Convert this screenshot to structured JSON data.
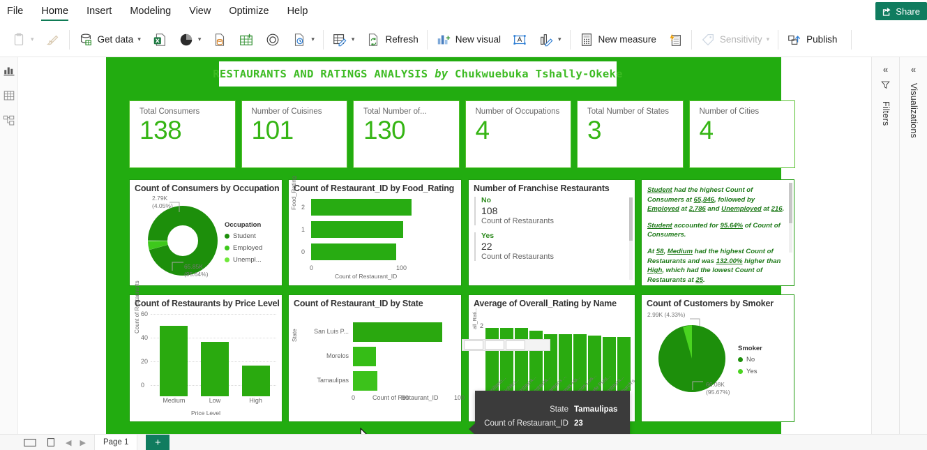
{
  "menu": {
    "items": [
      {
        "label": "File",
        "active": false
      },
      {
        "label": "Home",
        "active": true
      },
      {
        "label": "Insert",
        "active": false
      },
      {
        "label": "Modeling",
        "active": false
      },
      {
        "label": "View",
        "active": false
      },
      {
        "label": "Optimize",
        "active": false
      },
      {
        "label": "Help",
        "active": false
      }
    ],
    "share_label": "Share"
  },
  "ribbon": {
    "paste_label": "",
    "get_data_label": "Get data",
    "refresh_label": "Refresh",
    "new_visual_label": "New visual",
    "new_measure_label": "New measure",
    "sensitivity_label": "Sensitivity",
    "publish_label": "Publish"
  },
  "report": {
    "banner_main": "RESTAURANTS AND RATINGS ANALYSIS",
    "banner_by": "by",
    "banner_author": "Chukwuebuka Tshally-Okeke",
    "accent_green": "#22ac10",
    "kpi_green": "#35b514"
  },
  "kpis": [
    {
      "label": "Total Consumers",
      "value": "138"
    },
    {
      "label": "Number of Cuisines",
      "value": "101"
    },
    {
      "label": "Total Number of...",
      "value": "130"
    },
    {
      "label": "Number of Occupations",
      "value": "4"
    },
    {
      "label": "Total Number of States",
      "value": "3"
    },
    {
      "label": "Number of Cities",
      "value": "4"
    }
  ],
  "franchise": {
    "title": "Number of Franchise Restaurants",
    "rows": [
      {
        "category": "No",
        "value": "108",
        "measure": "Count of Restaurants"
      },
      {
        "category": "Yes",
        "value": "22",
        "measure": "Count of Restaurants"
      }
    ]
  },
  "insights": {
    "p1_a": "Student",
    "p1_b": " had the highest Count of Consumers at ",
    "p1_c": "65,846",
    "p1_d": ", followed by ",
    "p1_e": "Employed",
    "p1_f": " at ",
    "p1_g": "2,786",
    "p1_h": " and ",
    "p1_i": "Unemployed",
    "p1_j": " at ",
    "p1_k": "216",
    "p1_l": ".",
    "p2_a": "Student",
    "p2_b": " accounted for ",
    "p2_c": "95.64%",
    "p2_d": " of Count of Consumers.",
    "p3_a": "At ",
    "p3_b": "58",
    "p3_c": ", ",
    "p3_d": "Medium",
    "p3_e": " had the highest Count of Restaurants and was ",
    "p3_f": "132.00%",
    "p3_g": " higher than ",
    "p3_h": "High",
    "p3_i": ", which had the lowest Count of Restaurants at ",
    "p3_j": "25",
    "p3_k": "."
  },
  "tooltip": {
    "rows": [
      {
        "key": "State",
        "value": "Tamaulipas"
      },
      {
        "key": "Count of Restaurant_ID",
        "value": "23"
      }
    ]
  },
  "panels": {
    "filters_label": "Filters",
    "visualizations_label": "Visualizations",
    "collapse_icon": "«"
  },
  "statusbar": {
    "page_label": "Page 1",
    "add_page_label": "+"
  },
  "chart_data": [
    {
      "type": "pie",
      "title": "Count of Consumers by Occupation",
      "legend_title": "Occupation",
      "legend_position": "right",
      "slices": [
        {
          "name": "Student",
          "value": 65850,
          "display": "65.85K",
          "percent": "95.64%",
          "color": "#1d8f0b"
        },
        {
          "name": "Employed",
          "value": 2790,
          "display": "2.79K",
          "percent": "4.05%",
          "color": "#3ec81c"
        },
        {
          "name": "Unempl...",
          "value": 216,
          "display": "",
          "percent": "",
          "color": "#6fe83a"
        }
      ]
    },
    {
      "type": "bar",
      "title": "Count of Restaurant_ID by Food_Rating",
      "orientation": "horizontal",
      "ylabel": "Food_Rating",
      "xlabel": "Count of Restaurant_ID",
      "categories": [
        "2",
        "1",
        "0"
      ],
      "values": [
        118,
        108,
        100
      ],
      "xticks": [
        "0",
        "100"
      ],
      "xlim": [
        0,
        160
      ],
      "grid": true
    },
    {
      "type": "bar",
      "title": "Count of Restaurants by Price Level",
      "orientation": "vertical",
      "xlabel": "Price Level",
      "ylabel": "Count of Restaurants",
      "categories": [
        "Medium",
        "Low",
        "High"
      ],
      "values": [
        58,
        45,
        25
      ],
      "yticks": [
        "0",
        "20",
        "40",
        "60"
      ],
      "ylim": [
        0,
        62
      ],
      "grid": true
    },
    {
      "type": "bar",
      "title": "Count of Restaurant_ID by State",
      "orientation": "horizontal",
      "ylabel": "State",
      "xlabel": "Count of Restaurant_ID",
      "categories": [
        "San Luis P...",
        "Morelos",
        "Tamaulipas"
      ],
      "values": [
        85,
        22,
        23
      ],
      "xticks": [
        "0",
        "50",
        "100"
      ],
      "xlim": [
        0,
        100
      ],
      "grid": true
    },
    {
      "type": "bar",
      "title": "Average of Overall_Rating by Name",
      "orientation": "vertical",
      "xlabel": "Name",
      "ylabel": "all_Rati...",
      "categories": [
        "Emiliano...",
        "Michiko...",
        "Restaura...",
        "Restaura...",
        "Mariscos ...",
        "Jonas Ha...",
        "Tacos Los...",
        "Cafe Punt...",
        "Restaura...",
        "Church's"
      ],
      "values": [
        2.0,
        2.0,
        2.0,
        1.95,
        1.85,
        1.85,
        1.85,
        1.82,
        1.8,
        1.8
      ],
      "yticks": [
        "2"
      ],
      "ylim": [
        0,
        2.1
      ],
      "grid": false
    },
    {
      "type": "pie",
      "title": "Count of Customers by Smoker",
      "legend_title": "Smoker",
      "legend_position": "right",
      "slices": [
        {
          "name": "No",
          "value": 66080,
          "display": "66.08K",
          "percent": "95.67%",
          "color": "#1d8f0b"
        },
        {
          "name": "Yes",
          "value": 2990,
          "display": "2.99K",
          "percent": "4.33%",
          "color": "#4ad420"
        }
      ]
    }
  ]
}
